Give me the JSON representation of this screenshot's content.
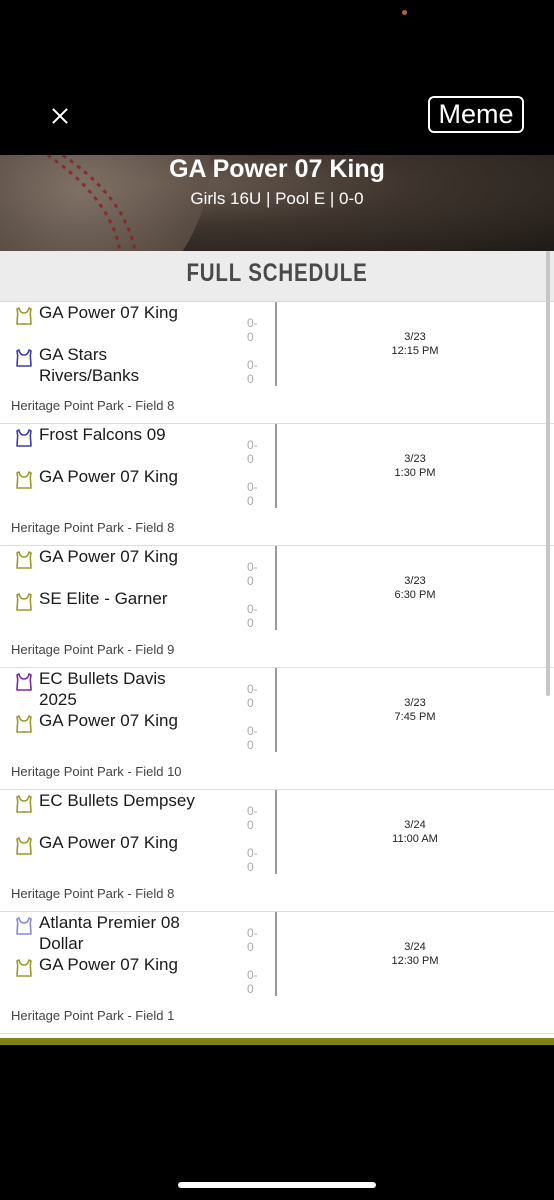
{
  "header": {
    "meme_button": "Meme",
    "close_icon": "close-icon"
  },
  "hero": {
    "title": "GA Power 07 King",
    "subtitle": "Girls 16U | Pool E | 0-0"
  },
  "section": {
    "title": "FULL SCHEDULE"
  },
  "games": [
    {
      "team1": {
        "name": "GA Power 07 King",
        "score": "0-0",
        "jersey_color": "#9a9a2a"
      },
      "team2": {
        "name": "GA Stars Rivers/Banks",
        "score": "0-0",
        "jersey_color": "#3a3ab0"
      },
      "date": "3/23",
      "time": "12:15 PM",
      "location": "Heritage Point Park - Field 8"
    },
    {
      "team1": {
        "name": "Frost Falcons 09",
        "score": "0-0",
        "jersey_color": "#3a3ab0"
      },
      "team2": {
        "name": "GA Power 07 King",
        "score": "0-0",
        "jersey_color": "#9a9a2a"
      },
      "date": "3/23",
      "time": "1:30 PM",
      "location": "Heritage Point Park - Field 8"
    },
    {
      "team1": {
        "name": "GA Power 07 King",
        "score": "0-0",
        "jersey_color": "#9a9a2a"
      },
      "team2": {
        "name": "SE Elite - Garner",
        "score": "0-0",
        "jersey_color": "#9a9a2a"
      },
      "date": "3/23",
      "time": "6:30 PM",
      "location": "Heritage Point Park - Field 9"
    },
    {
      "team1": {
        "name": "EC Bullets Davis 2025",
        "score": "0-0",
        "jersey_color": "#7a2a9a"
      },
      "team2": {
        "name": "GA Power 07 King",
        "score": "0-0",
        "jersey_color": "#9a9a2a"
      },
      "date": "3/23",
      "time": "7:45 PM",
      "location": "Heritage Point Park - Field 10"
    },
    {
      "team1": {
        "name": "EC Bullets Dempsey",
        "score": "0-0",
        "jersey_color": "#9a9a2a"
      },
      "team2": {
        "name": "GA Power 07 King",
        "score": "0-0",
        "jersey_color": "#9a9a2a"
      },
      "date": "3/24",
      "time": "11:00 AM",
      "location": "Heritage Point Park - Field 8"
    },
    {
      "team1": {
        "name": "Atlanta Premier 08 Dollar",
        "score": "0-0",
        "jersey_color": "#8a8ad8"
      },
      "team2": {
        "name": "GA Power 07 King",
        "score": "0-0",
        "jersey_color": "#9a9a2a"
      },
      "date": "3/24",
      "time": "12:30 PM",
      "location": "Heritage Point Park - Field 1"
    }
  ]
}
